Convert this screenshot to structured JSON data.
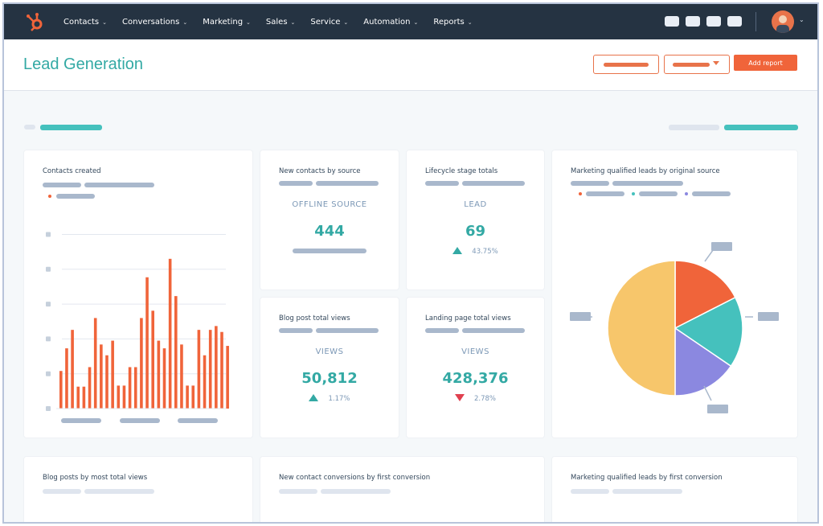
{
  "nav": {
    "items": [
      {
        "label": "Contacts"
      },
      {
        "label": "Conversations"
      },
      {
        "label": "Marketing"
      },
      {
        "label": "Sales"
      },
      {
        "label": "Service"
      },
      {
        "label": "Automation"
      },
      {
        "label": "Reports"
      }
    ],
    "chevron": "⌄"
  },
  "header": {
    "title": "Lead Generation",
    "add_report": "Add report"
  },
  "colors": {
    "nav": "#253342",
    "teal": "#33a9a4",
    "orange": "#f0643a",
    "up": "#33a9a4",
    "down": "#e0404f"
  },
  "cards": {
    "contacts_created": {
      "title": "Contacts created"
    },
    "new_contacts": {
      "title": "New contacts by source",
      "label": "OFFLINE SOURCE",
      "value": "444"
    },
    "lifecycle": {
      "title": "Lifecycle stage totals",
      "label": "LEAD",
      "value": "69",
      "change": "43.75%",
      "direction": "up"
    },
    "blog_views": {
      "title": "Blog post total views",
      "label": "VIEWS",
      "value": "50,812",
      "change": "1.17%",
      "direction": "up"
    },
    "landing_views": {
      "title": "Landing page total views",
      "label": "VIEWS",
      "value": "428,376",
      "change": "2.78%",
      "direction": "down"
    },
    "mql_source": {
      "title": "Marketing qualified leads by original source"
    },
    "blog_posts": {
      "title": "Blog posts by most total views"
    },
    "conversions": {
      "title": "New contact conversions by first conversion"
    },
    "mql_conversion": {
      "title": "Marketing qualified leads by first conversion"
    }
  },
  "chart_data": [
    {
      "type": "bar",
      "title": "Contacts created",
      "color": "#f0643a",
      "grid": true,
      "ylim": [
        0,
        5
      ],
      "values": [
        1.08,
        1.73,
        2.26,
        0.63,
        0.63,
        1.19,
        2.6,
        1.84,
        1.53,
        1.95,
        0.66,
        0.66,
        1.19,
        1.19,
        2.6,
        3.77,
        2.81,
        1.95,
        1.73,
        4.3,
        3.23,
        1.84,
        0.66,
        0.66,
        2.26,
        1.53,
        2.26,
        2.37,
        2.2,
        1.8
      ]
    },
    {
      "type": "pie",
      "title": "Marketing qualified leads by original source",
      "slices": [
        {
          "value": 17.5,
          "color": "#f0643a"
        },
        {
          "value": 17,
          "color": "#45c1bd"
        },
        {
          "value": 15.5,
          "color": "#8b88e0"
        },
        {
          "value": 50,
          "color": "#f7c66b"
        }
      ]
    }
  ]
}
